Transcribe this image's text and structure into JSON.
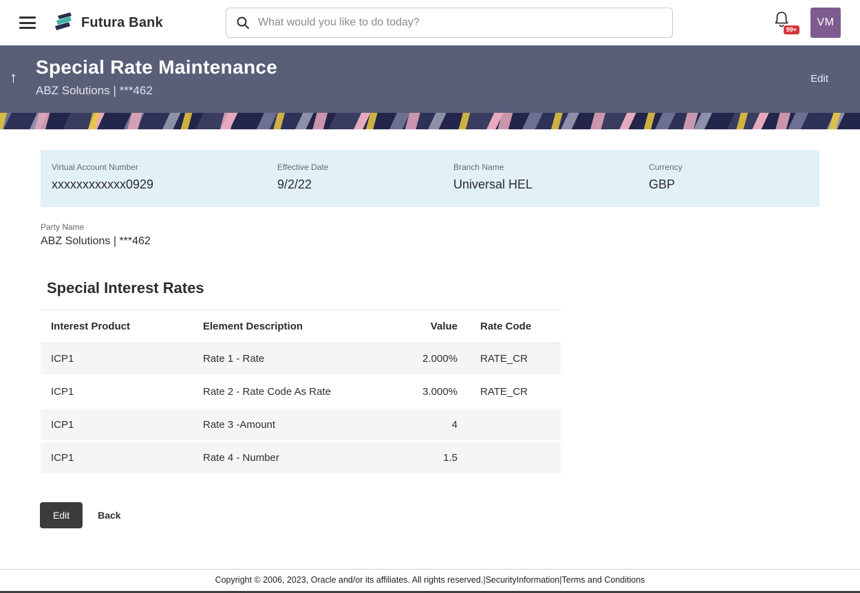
{
  "header": {
    "brand": "Futura Bank",
    "search_placeholder": "What would you like to do today?",
    "notification_badge": "99+",
    "avatar_initials": "VM"
  },
  "banner": {
    "title": "Special Rate Maintenance",
    "subtitle": "ABZ Solutions | ***462",
    "edit_label": "Edit",
    "back_arrow": "↑"
  },
  "summary": {
    "fields": [
      {
        "label": "Virtual Account Number",
        "value": "xxxxxxxxxxxx0929"
      },
      {
        "label": "Effective Date",
        "value": "9/2/22"
      },
      {
        "label": "Branch Name",
        "value": "Universal HEL"
      },
      {
        "label": "Currency",
        "value": "GBP"
      }
    ],
    "party": {
      "label": "Party Name",
      "value": "ABZ Solutions | ***462"
    }
  },
  "rates": {
    "title": "Special Interest Rates",
    "columns": [
      "Interest Product",
      "Element Description",
      "Value",
      "Rate Code"
    ],
    "rows": [
      {
        "product": "ICP1",
        "description": "Rate 1 - Rate",
        "value": "2.000%",
        "rate_code": "RATE_CR"
      },
      {
        "product": "ICP1",
        "description": "Rate 2 - Rate Code As Rate",
        "value": "3.000%",
        "rate_code": "RATE_CR"
      },
      {
        "product": "ICP1",
        "description": "Rate 3 -Amount",
        "value": "4",
        "rate_code": ""
      },
      {
        "product": "ICP1",
        "description": "Rate 4 - Number",
        "value": "1.5",
        "rate_code": ""
      }
    ]
  },
  "actions": {
    "edit": "Edit",
    "back": "Back"
  },
  "footer": {
    "copyright": "Copyright © 2006, 2023, Oracle and/or its affiliates. All rights reserved.",
    "separator": "|",
    "links": [
      "SecurityInformation",
      "Terms and Conditions"
    ]
  },
  "colors": {
    "banner": "#5a5f78",
    "summary_panel": "#e2f0f8",
    "avatar": "#7d5d91",
    "badge": "#d6373c",
    "primary_button": "#3b3b3b"
  }
}
